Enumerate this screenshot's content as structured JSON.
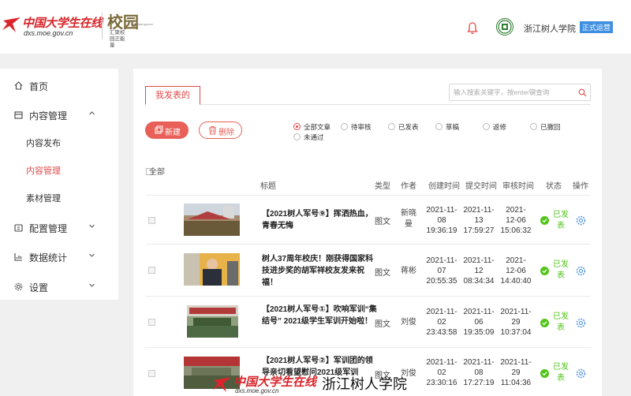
{
  "header": {
    "brand_name": "中国大学生在线",
    "brand_url": "dxs.moe.gov.cn",
    "sub_brand": "校园",
    "sub_brand_caption": "汇聚校园正能量",
    "sub_brand_url": "dxs.moe.gov.cn",
    "school_name": "浙江树人学院",
    "status_tag": "正式运营"
  },
  "sidebar": {
    "items": [
      {
        "label": "首页",
        "icon": "home-icon"
      },
      {
        "label": "内容管理",
        "icon": "content-icon",
        "expanded": true
      },
      {
        "label": "配置管理",
        "icon": "config-icon"
      },
      {
        "label": "数据统计",
        "icon": "chart-icon"
      },
      {
        "label": "设置",
        "icon": "settings-icon"
      }
    ],
    "sub_items": [
      {
        "label": "内容发布"
      },
      {
        "label": "内容管理",
        "active": true
      },
      {
        "label": "素材管理"
      }
    ]
  },
  "main": {
    "tab_label": "我发表的",
    "search_placeholder": "输入搜索关键字，按enter键查询",
    "new_button": "新建",
    "delete_button": "删除",
    "filters": [
      {
        "label": "全部文章",
        "selected": true
      },
      {
        "label": "待审核",
        "selected": false
      },
      {
        "label": "已发表",
        "selected": false
      },
      {
        "label": "草稿",
        "selected": false
      },
      {
        "label": "返修",
        "selected": false
      },
      {
        "label": "已撤回",
        "selected": false
      },
      {
        "label": "未通过",
        "selected": false
      }
    ],
    "table": {
      "select_all": "全部",
      "headers": [
        "标题",
        "类型",
        "作者",
        "创建时间",
        "提交时间",
        "审核时间",
        "状态",
        "操作"
      ],
      "rows": [
        {
          "title": "【2021树人军号⑨】挥洒热血，青春无悔",
          "type": "图文",
          "author": "新晓曼",
          "created": "2021-11-08 19:36:19",
          "submitted": "2021-11-13 17:59:27",
          "reviewed": "2021-12-06 15:06:32",
          "status": "已发表"
        },
        {
          "title": "树人37周年校庆！刚获得国家科技进步奖的胡军祥校友发来祝福！",
          "type": "图文",
          "author": "蒋彬",
          "created": "2021-11-07 20:55:35",
          "submitted": "2021-11-12 08:34:34",
          "reviewed": "2021-12-06 14:40:40",
          "status": "已发表"
        },
        {
          "title": "【2021树人军号①】吹响军训“集结号” 2021级学生军训开始啦！",
          "type": "图文",
          "author": "刘俊",
          "created": "2021-11-02 23:43:58",
          "submitted": "2021-11-06 19:35:09",
          "reviewed": "2021-11-29 10:37:04",
          "status": "已发表"
        },
        {
          "title": "【2021树人军号②】军训团的领导亲切看望慰问2021级军训",
          "type": "图文",
          "author": "刘俊",
          "created": "2021-11-02 23:30:16",
          "submitted": "2021-11-08 17:27:19",
          "reviewed": "2021-11-29 11:04:36",
          "status": "已发表"
        }
      ]
    }
  },
  "watermark": {
    "brand_name": "中国大学生在线",
    "brand_url": "dxs.moe.gov.cn",
    "school_name": "浙江树人学院"
  },
  "colors": {
    "accent": "#e14b4b",
    "button_red": "#e86058",
    "success": "#52c41a",
    "tag_blue": "#3f8fe0",
    "settings_blue": "#4a90e2"
  }
}
